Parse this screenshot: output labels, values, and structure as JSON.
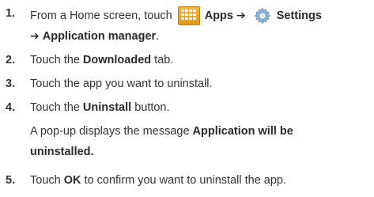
{
  "steps": [
    {
      "number": "1.",
      "line1": {
        "prefix": "From a Home screen, touch",
        "apps_label": "Apps",
        "settings_label": "Settings"
      },
      "line2": {
        "target": "Application manager",
        "suffix": "."
      }
    },
    {
      "number": "2.",
      "before": "Touch the",
      "bold": "Downloaded",
      "after": "tab."
    },
    {
      "number": "3.",
      "text": "Touch the app you want to uninstall."
    },
    {
      "number": "4.",
      "before": "Touch the",
      "bold": "Uninstall",
      "after": "button.",
      "note_line1_before": "A pop-up displays the message",
      "note_line1_bold": "Application will be",
      "note_line2_bold": "uninstalled."
    },
    {
      "number": "5.",
      "before": "Touch",
      "bold": "OK",
      "after": "to confirm you want to uninstall the app."
    }
  ],
  "icons": {
    "apps": "apps-grid-icon",
    "settings": "gear-icon",
    "arrow": "right-arrow"
  },
  "colors": {
    "text": "#2b2b2b",
    "apps_icon": "#e8a326",
    "settings_icon": "#7aa7d6"
  }
}
